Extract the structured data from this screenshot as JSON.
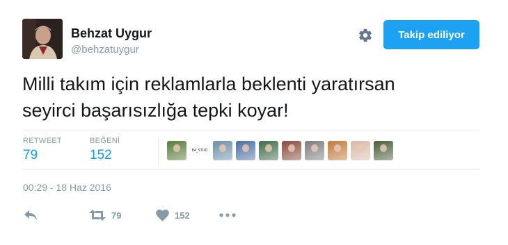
{
  "author": {
    "name": "Behzat Uygur",
    "handle": "@behzatuygur"
  },
  "follow_button": {
    "label": "Takip ediliyor"
  },
  "tweet": {
    "line1": "Milli takım için reklamlarla beklenti yaratırsan",
    "line2": "seyirci başarısızlığa tepki koyar!"
  },
  "stats": {
    "retweet_label": "RETWEET",
    "retweet_count": "79",
    "like_label": "BEĞENİ",
    "like_count": "152"
  },
  "likers": [
    {
      "kind": "photo",
      "color": "#5a7a3a"
    },
    {
      "kind": "text",
      "text": "EA_STUD"
    },
    {
      "kind": "photo",
      "color": "#6a8fa8"
    },
    {
      "kind": "photo",
      "color": "#4b6fa3"
    },
    {
      "kind": "photo",
      "color": "#3f6b4a"
    },
    {
      "kind": "photo",
      "color": "#8a4a3a"
    },
    {
      "kind": "photo",
      "color": "#7c7c7c"
    },
    {
      "kind": "photo",
      "color": "#c07a3a"
    },
    {
      "kind": "photo",
      "color": "#d9b8a8"
    },
    {
      "kind": "photo",
      "color": "#4a5e3a"
    }
  ],
  "timestamp": "00:29 - 18 Haz 2016",
  "actions": {
    "reply_icon": "reply-icon",
    "retweet_icon": "retweet-icon",
    "retweet_count": "79",
    "like_icon": "heart-icon",
    "like_count": "152",
    "more_icon": "more-icon"
  },
  "colors": {
    "accent": "#1da1f2",
    "link": "#1b95e0",
    "muted": "#8899a6"
  }
}
